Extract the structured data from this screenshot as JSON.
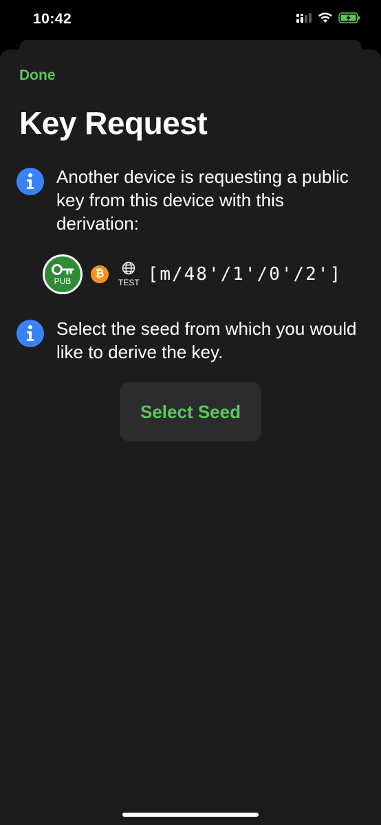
{
  "status_bar": {
    "time": "10:42",
    "icons": [
      "cellular-signal-icon",
      "wifi-icon",
      "battery-charging-icon"
    ],
    "battery_color": "#5cc85a"
  },
  "header": {
    "done_label": "Done",
    "title": "Key Request"
  },
  "info": {
    "request_message": "Another device is requesting a public key from this device with this derivation:",
    "select_message": "Select the seed from which you would like to derive the key."
  },
  "derivation": {
    "key_badge_label": "PUB",
    "coin_symbol": "₿",
    "network_label": "TEST",
    "path": "[m/48'/1'/0'/2']"
  },
  "actions": {
    "select_seed_label": "Select Seed"
  },
  "colors": {
    "accent": "#5cc85a",
    "info_blue": "#3a82f7",
    "bitcoin_orange": "#f7931a",
    "sheet_background": "#1c1c1e"
  }
}
